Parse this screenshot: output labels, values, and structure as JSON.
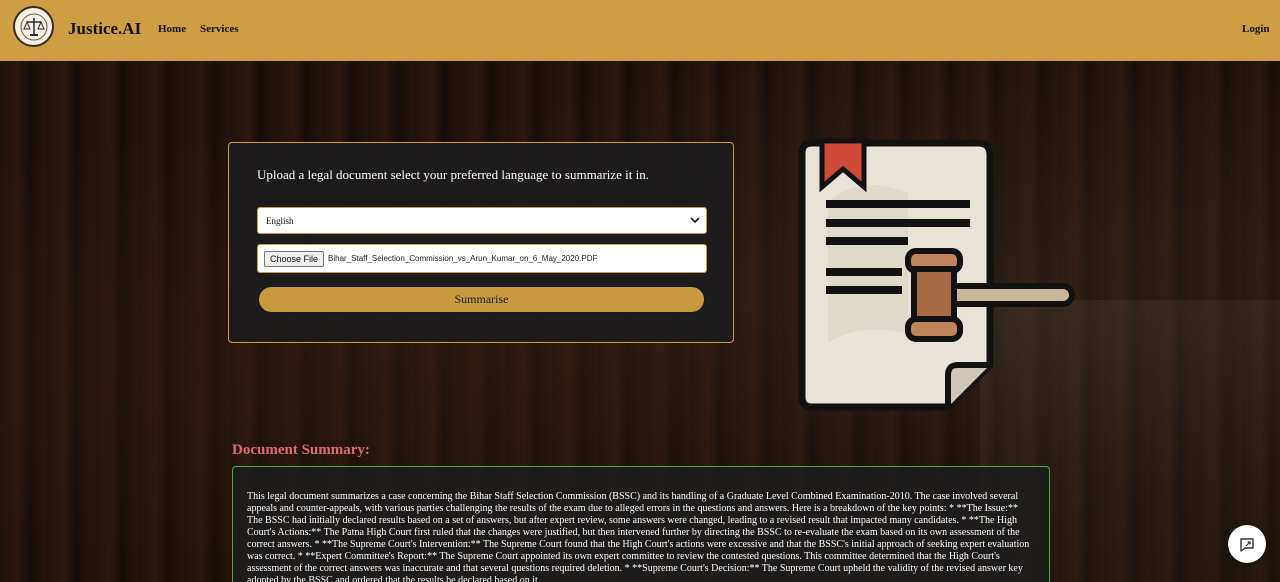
{
  "navbar": {
    "brand": "Justice.AI",
    "links": [
      "Home",
      "Services"
    ],
    "login": "Login",
    "logo_icon": "scales-of-justice-icon"
  },
  "upload": {
    "title": "Upload a legal document select your preferred language to summarize it in.",
    "language_selected": "English",
    "file_button": "Choose File",
    "file_name": "Bihar_Staff_Selection_Commission_vs_Arun_Kumar_on_6_May_2020.PDF",
    "submit_label": "Summarise"
  },
  "summary": {
    "heading": "Document Summary:",
    "text": "This legal document summarizes a case concerning the Bihar Staff Selection Commission (BSSC) and its handling of a Graduate Level Combined Examination-2010. The case involved several appeals and counter-appeals, with various parties challenging the results of the exam due to alleged errors in the questions and answers. Here is a breakdown of the key points: * **The Issue:** The BSSC had initially declared results based on a set of answers, but after expert review, some answers were changed, leading to a revised result that impacted many candidates. * **The High Court's Actions:** The Patna High Court first ruled that the changes were justified, but then intervened further by directing the BSSC to re-evaluate the exam based on its own assessment of the correct answers. * **The Supreme Court's Intervention:** The Supreme Court found that the High Court's actions were excessive and that the BSSC's initial approach of seeking expert evaluation was correct. * **Expert Committee's Report:** The Supreme Court appointed its own expert committee to review the contested questions. This committee determined that the High Court's assessment of the correct answers was inaccurate and that several questions required deletion. * **Supreme Court's Decision:** The Supreme Court upheld the validity of the revised answer key adopted by the BSSC and ordered that the results be declared based on it."
  },
  "colors": {
    "accent": "#cf9e44",
    "summary_heading": "#e06a73",
    "summary_border": "#3fae48"
  },
  "icons": {
    "illustration": "legal-document-gavel-icon",
    "chat": "chat-expand-icon",
    "select_chevron": "chevron-down-icon"
  }
}
